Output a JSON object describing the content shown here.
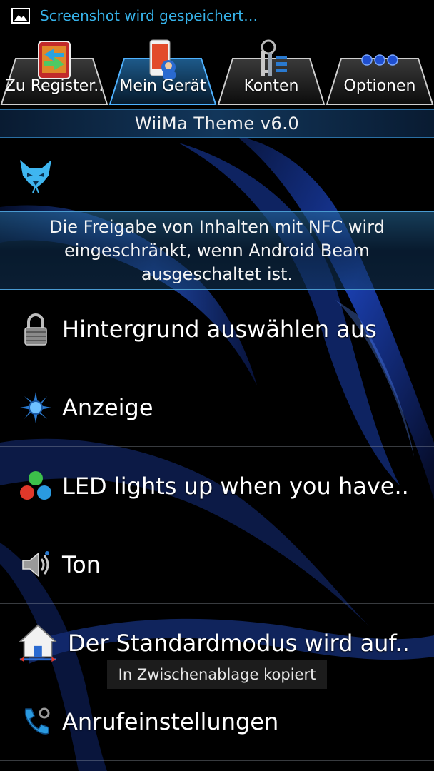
{
  "status_bar": {
    "notification_text": "Screenshot wird gespeichert…"
  },
  "tabs": [
    {
      "label": "Zu Register..",
      "icon": "register-icon"
    },
    {
      "label": "Mein Gerät",
      "icon": "device-icon"
    },
    {
      "label": "Konten",
      "icon": "keys-icon"
    },
    {
      "label": "Optionen",
      "icon": "options-icon"
    }
  ],
  "header": {
    "title": "WiiMa Theme v6.0"
  },
  "nfc_notice": "Die Freigabe von Inhalten mit NFC wird eingeschränkt, wenn Android Beam ausgeschaltet ist.",
  "menu": [
    {
      "label": "Hintergrund auswählen aus",
      "icon": "lock-icon"
    },
    {
      "label": "Anzeige",
      "icon": "display-icon"
    },
    {
      "label": "LED lights up when you have..",
      "icon": "led-icon"
    },
    {
      "label": "Ton",
      "icon": "speaker-icon"
    },
    {
      "label": "Der Standardmodus wird auf..",
      "icon": "home-icon"
    },
    {
      "label": "Anrufeinstellungen",
      "icon": "phone-icon"
    }
  ],
  "toast": {
    "text": "In Zwischenablage kopiert"
  },
  "colors": {
    "accent": "#37b3ea",
    "title_border": "#2a6fa3",
    "background": "#000000"
  }
}
